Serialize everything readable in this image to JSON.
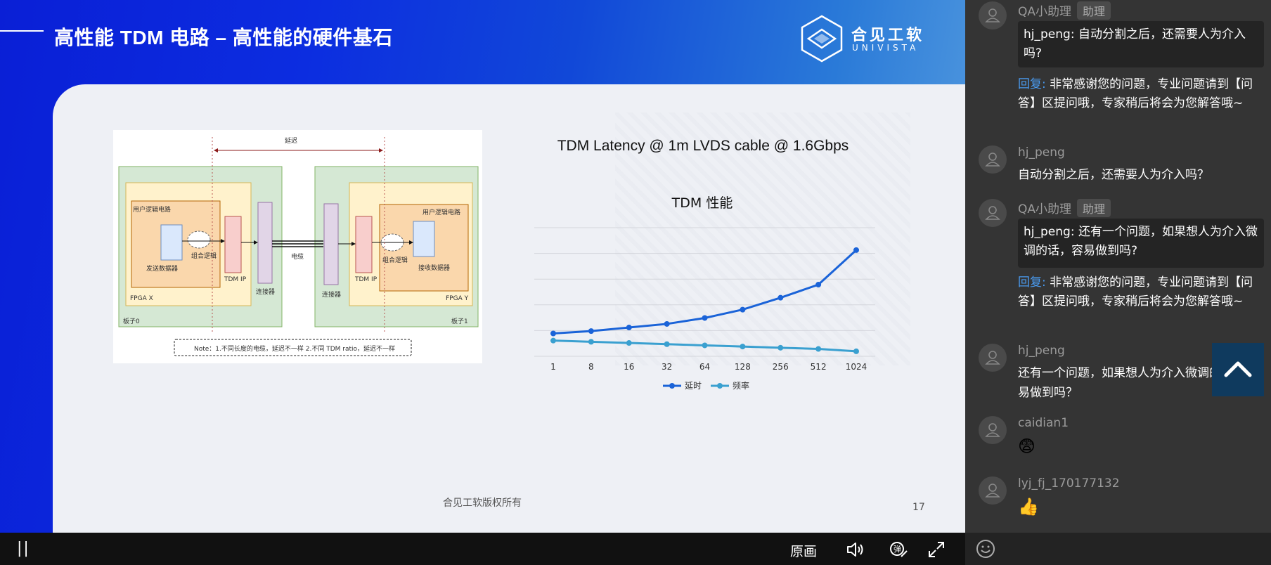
{
  "slide": {
    "title": "高性能 TDM 电路 – 高性能的硬件基石",
    "logo_cn": "合见工软",
    "logo_en": "UNIVISTA",
    "copyright": "合见工软版权所有",
    "page_number": "17"
  },
  "diagram": {
    "latency_label": "延迟",
    "user_logic_left": "用户逻辑电路",
    "user_logic_right": "用户逻辑电路",
    "sender": "发送数据器",
    "receiver": "接收数据器",
    "combo_left": "组合逻辑",
    "combo_right": "组合逻辑",
    "tdm_ip_left": "TDM IP",
    "tdm_ip_right": "TDM IP",
    "connector_left": "连接器",
    "connector_right": "连接器",
    "cable": "电缆",
    "fpga_x": "FPGA X",
    "fpga_y": "FPGA Y",
    "board0": "板子0",
    "board1": "板子1",
    "note": "Note：1.不同长度的电缆，延迟不一样 2.不同 TDM ratio，延迟不一样"
  },
  "chart_data": {
    "type": "line",
    "title": "TDM Latency @ 1m LVDS cable @ 1.6Gbps",
    "subtitle": "TDM 性能",
    "categories": [
      "1",
      "8",
      "16",
      "32",
      "64",
      "128",
      "256",
      "512",
      "1024"
    ],
    "series": [
      {
        "name": "延时",
        "color": "#1a63d8",
        "values": [
          0.5,
          0.6,
          0.75,
          0.9,
          1.15,
          1.5,
          2.0,
          2.55,
          4.0
        ]
      },
      {
        "name": "频率",
        "color": "#3aa0d0",
        "values": [
          0.2,
          0.15,
          0.1,
          0.05,
          0.0,
          -0.05,
          -0.1,
          -0.15,
          -0.25
        ]
      }
    ],
    "ylim": [
      -0.4,
      5.0
    ],
    "grid": true,
    "legend": "bottom"
  },
  "player": {
    "pause_label": "||",
    "quality_label": "原画",
    "icons": [
      "volume-icon",
      "danmaku-icon",
      "fullscreen-icon"
    ]
  },
  "chat": {
    "messages": [
      {
        "name": "QA小助理",
        "badge": "助理",
        "quote": "hj_peng: 自动分割之后，还需要人为介入吗?",
        "reply_label": "回复:",
        "reply": " 非常感谢您的问题，专业问题请到【问答】区提问哦，专家稍后将会为您解答哦~"
      },
      {
        "name": "hj_peng",
        "text": "自动分割之后，还需要人为介入吗？"
      },
      {
        "name": "QA小助理",
        "badge": "助理",
        "quote": "hj_peng: 还有一个问题，如果想人为介入微调的话，容易做到吗?",
        "reply_label": "回复:",
        "reply": " 非常感谢您的问题，专业问题请到【问答】区提问哦，专家稍后将会为您解答哦~"
      },
      {
        "name": "hj_peng",
        "text": "还有一个问题，如果想人为介入微调的话，容易做到吗？"
      },
      {
        "name": "caidian1",
        "emoji": "😨"
      },
      {
        "name": "lyj_fj_170177132",
        "emoji": "👍"
      }
    ]
  },
  "colors": {
    "slide_blue": "#0c2de0",
    "chart_line_primary": "#1a63d8",
    "chart_line_secondary": "#3aa0d0",
    "reply_link": "#4a9bf0",
    "chat_bg": "#343434"
  }
}
